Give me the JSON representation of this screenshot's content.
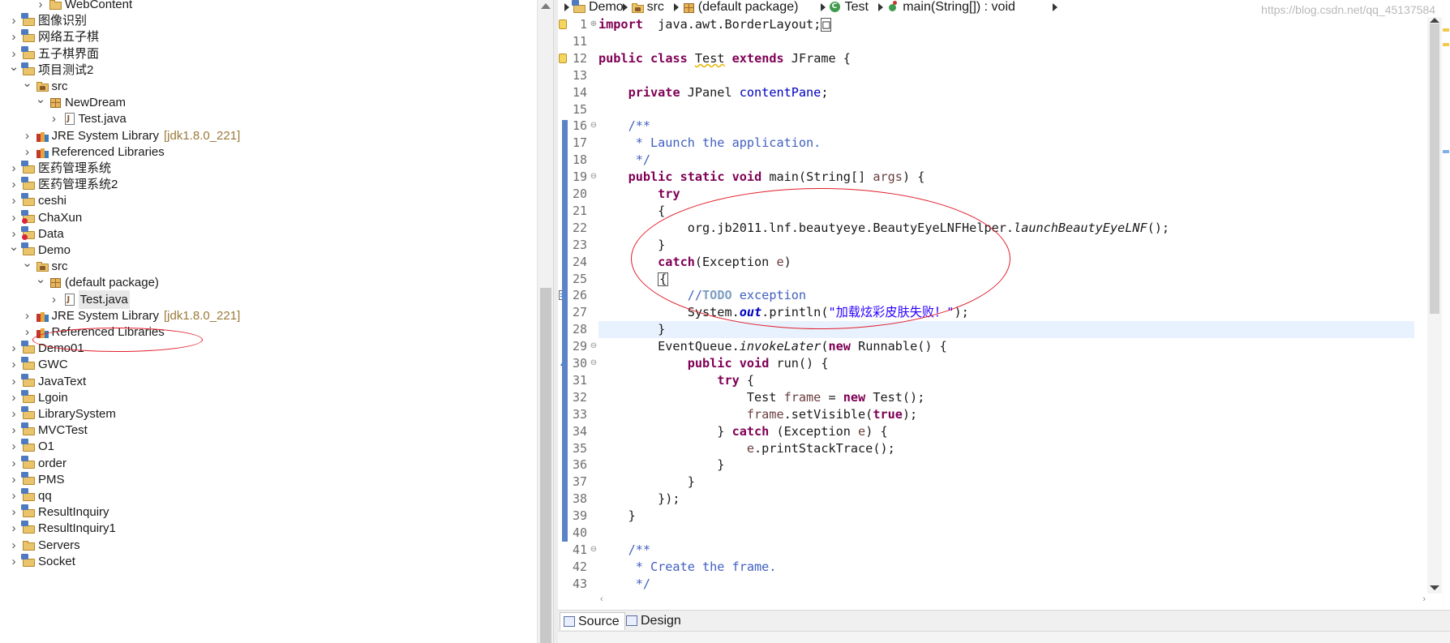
{
  "explorer": {
    "items": [
      {
        "label": "WebContent",
        "decoration": "",
        "twisty": "collapsed",
        "icon": "folder-icon",
        "indent": 2,
        "selected": false
      },
      {
        "label": "图像识别",
        "decoration": "",
        "twisty": "collapsed",
        "icon": "java-project-icon",
        "indent": 0,
        "selected": false
      },
      {
        "label": "网络五子棋",
        "decoration": "",
        "twisty": "collapsed",
        "icon": "java-project-icon",
        "indent": 0,
        "selected": false
      },
      {
        "label": "五子棋界面",
        "decoration": "",
        "twisty": "collapsed",
        "icon": "java-project-icon",
        "indent": 0,
        "selected": false
      },
      {
        "label": "项目测试2",
        "decoration": "",
        "twisty": "expanded",
        "icon": "java-project-icon",
        "indent": 0,
        "selected": false
      },
      {
        "label": "src",
        "decoration": "",
        "twisty": "expanded",
        "icon": "source-folder-icon",
        "indent": 1,
        "selected": false
      },
      {
        "label": "NewDream",
        "decoration": "",
        "twisty": "expanded",
        "icon": "package-icon",
        "indent": 2,
        "selected": false
      },
      {
        "label": "Test.java",
        "decoration": "",
        "twisty": "collapsed",
        "icon": "java-file-icon",
        "indent": 3,
        "selected": false
      },
      {
        "label": "JRE System Library",
        "decoration": "[jdk1.8.0_221]",
        "twisty": "collapsed",
        "icon": "library-icon",
        "indent": 1,
        "selected": false
      },
      {
        "label": "Referenced Libraries",
        "decoration": "",
        "twisty": "collapsed",
        "icon": "library-icon",
        "indent": 1,
        "selected": false
      },
      {
        "label": "医药管理系统",
        "decoration": "",
        "twisty": "collapsed",
        "icon": "java-project-icon",
        "indent": 0,
        "selected": false
      },
      {
        "label": "医药管理系统2",
        "decoration": "",
        "twisty": "collapsed",
        "icon": "java-project-icon",
        "indent": 0,
        "selected": false
      },
      {
        "label": "ceshi",
        "decoration": "",
        "twisty": "collapsed",
        "icon": "java-project-icon",
        "indent": 0,
        "selected": false
      },
      {
        "label": "ChaXun",
        "decoration": "",
        "twisty": "collapsed",
        "icon": "java-project-error-icon",
        "indent": 0,
        "selected": false
      },
      {
        "label": "Data",
        "decoration": "",
        "twisty": "collapsed",
        "icon": "java-project-error-icon",
        "indent": 0,
        "selected": false
      },
      {
        "label": "Demo",
        "decoration": "",
        "twisty": "expanded",
        "icon": "java-project-icon",
        "indent": 0,
        "selected": false
      },
      {
        "label": "src",
        "decoration": "",
        "twisty": "expanded",
        "icon": "source-folder-icon",
        "indent": 1,
        "selected": false
      },
      {
        "label": "(default package)",
        "decoration": "",
        "twisty": "expanded",
        "icon": "package-icon",
        "indent": 2,
        "selected": false
      },
      {
        "label": "Test.java",
        "decoration": "",
        "twisty": "collapsed",
        "icon": "java-file-icon",
        "indent": 3,
        "selected": true
      },
      {
        "label": "JRE System Library",
        "decoration": "[jdk1.8.0_221]",
        "twisty": "collapsed",
        "icon": "library-icon",
        "indent": 1,
        "selected": false
      },
      {
        "label": "Referenced Libraries",
        "decoration": "",
        "twisty": "collapsed",
        "icon": "library-icon",
        "indent": 1,
        "selected": false
      },
      {
        "label": "Demo01",
        "decoration": "",
        "twisty": "collapsed",
        "icon": "java-project-icon",
        "indent": 0,
        "selected": false
      },
      {
        "label": "GWC",
        "decoration": "",
        "twisty": "collapsed",
        "icon": "java-project-icon",
        "indent": 0,
        "selected": false
      },
      {
        "label": "JavaText",
        "decoration": "",
        "twisty": "collapsed",
        "icon": "java-project-icon",
        "indent": 0,
        "selected": false
      },
      {
        "label": "Lgoin",
        "decoration": "",
        "twisty": "collapsed",
        "icon": "java-project-icon",
        "indent": 0,
        "selected": false
      },
      {
        "label": "LibrarySystem",
        "decoration": "",
        "twisty": "collapsed",
        "icon": "java-project-icon",
        "indent": 0,
        "selected": false
      },
      {
        "label": "MVCTest",
        "decoration": "",
        "twisty": "collapsed",
        "icon": "java-project-icon",
        "indent": 0,
        "selected": false
      },
      {
        "label": "O1",
        "decoration": "",
        "twisty": "collapsed",
        "icon": "java-project-icon",
        "indent": 0,
        "selected": false
      },
      {
        "label": "order",
        "decoration": "",
        "twisty": "collapsed",
        "icon": "java-project-icon",
        "indent": 0,
        "selected": false
      },
      {
        "label": "PMS",
        "decoration": "",
        "twisty": "collapsed",
        "icon": "java-project-icon",
        "indent": 0,
        "selected": false
      },
      {
        "label": "qq",
        "decoration": "",
        "twisty": "collapsed",
        "icon": "java-project-icon",
        "indent": 0,
        "selected": false
      },
      {
        "label": "ResultInquiry",
        "decoration": "",
        "twisty": "collapsed",
        "icon": "java-project-icon",
        "indent": 0,
        "selected": false
      },
      {
        "label": "ResultInquiry1",
        "decoration": "",
        "twisty": "collapsed",
        "icon": "java-project-icon",
        "indent": 0,
        "selected": false
      },
      {
        "label": "Servers",
        "decoration": "",
        "twisty": "collapsed",
        "icon": "folder-icon",
        "indent": 0,
        "selected": false
      },
      {
        "label": "Socket",
        "decoration": "",
        "twisty": "collapsed",
        "icon": "java-project-icon",
        "indent": 0,
        "selected": false
      }
    ]
  },
  "breadcrumb": [
    {
      "label": "Demo",
      "icon": "java-project-icon"
    },
    {
      "label": "src",
      "icon": "source-folder-icon"
    },
    {
      "label": "(default package)",
      "icon": "package-icon"
    },
    {
      "label": "Test",
      "icon": "class-icon"
    },
    {
      "label": "main(String[]) : void",
      "icon": "method-icon"
    }
  ],
  "editor": {
    "current_line": 28,
    "lines": [
      {
        "num": "1",
        "fold": "⊕",
        "marker": "warning",
        "segments": [
          [
            "kw",
            "import"
          ],
          [
            "",
            "  java.awt.BorderLayout;"
          ],
          [
            "box",
            "□"
          ]
        ]
      },
      {
        "num": "11",
        "fold": "",
        "marker": "",
        "segments": []
      },
      {
        "num": "12",
        "fold": "",
        "marker": "warning",
        "segments": [
          [
            "kw",
            "public"
          ],
          [
            "",
            " "
          ],
          [
            "kw",
            "class"
          ],
          [
            "",
            " "
          ],
          [
            "warn",
            "Test"
          ],
          [
            "",
            " "
          ],
          [
            "kw",
            "extends"
          ],
          [
            "",
            " JFrame {"
          ]
        ]
      },
      {
        "num": "13",
        "fold": "",
        "marker": "",
        "segments": []
      },
      {
        "num": "14",
        "fold": "",
        "marker": "",
        "segments": [
          [
            "",
            "    "
          ],
          [
            "kw",
            "private"
          ],
          [
            "",
            " JPanel "
          ],
          [
            "fld",
            "contentPane"
          ],
          [
            "",
            ";"
          ]
        ]
      },
      {
        "num": "15",
        "fold": "",
        "marker": "",
        "segments": []
      },
      {
        "num": "16",
        "fold": "⊖",
        "marker": "",
        "segments": [
          [
            "",
            "    "
          ],
          [
            "cm",
            "/**"
          ]
        ]
      },
      {
        "num": "17",
        "fold": "",
        "marker": "",
        "segments": [
          [
            "",
            "     "
          ],
          [
            "cm",
            "* Launch the application."
          ]
        ]
      },
      {
        "num": "18",
        "fold": "",
        "marker": "",
        "segments": [
          [
            "",
            "     "
          ],
          [
            "cm",
            "*/"
          ]
        ]
      },
      {
        "num": "19",
        "fold": "⊖",
        "marker": "",
        "segments": [
          [
            "",
            "    "
          ],
          [
            "kw",
            "public"
          ],
          [
            "",
            " "
          ],
          [
            "kw",
            "static"
          ],
          [
            "",
            " "
          ],
          [
            "kw",
            "void"
          ],
          [
            "",
            " main(String[] "
          ],
          [
            "loc",
            "args"
          ],
          [
            "",
            ") {"
          ]
        ]
      },
      {
        "num": "20",
        "fold": "",
        "marker": "",
        "segments": [
          [
            "",
            "        "
          ],
          [
            "kw",
            "try"
          ]
        ]
      },
      {
        "num": "21",
        "fold": "",
        "marker": "",
        "segments": [
          [
            "",
            "        {"
          ]
        ]
      },
      {
        "num": "22",
        "fold": "",
        "marker": "",
        "segments": [
          [
            "",
            "            org.jb2011.lnf.beautyeye.BeautyEyeLNFHelper."
          ],
          [
            "ital",
            "launchBeautyEyeLNF"
          ],
          [
            "",
            "();"
          ]
        ]
      },
      {
        "num": "23",
        "fold": "",
        "marker": "",
        "segments": [
          [
            "",
            "        }"
          ]
        ]
      },
      {
        "num": "24",
        "fold": "",
        "marker": "",
        "segments": [
          [
            "",
            "        "
          ],
          [
            "kw",
            "catch"
          ],
          [
            "",
            "(Exception "
          ],
          [
            "loc",
            "e"
          ],
          [
            "",
            ")"
          ]
        ]
      },
      {
        "num": "25",
        "fold": "",
        "marker": "",
        "segments": [
          [
            "",
            "        "
          ],
          [
            "box",
            "{"
          ]
        ]
      },
      {
        "num": "26",
        "fold": "",
        "marker": "task",
        "segments": [
          [
            "",
            "            "
          ],
          [
            "cm",
            "//"
          ],
          [
            "tk",
            "TODO"
          ],
          [
            "cm",
            " exception"
          ]
        ]
      },
      {
        "num": "27",
        "fold": "",
        "marker": "",
        "segments": [
          [
            "",
            "            System."
          ],
          [
            "sfld",
            "out"
          ],
          [
            "",
            ".println("
          ],
          [
            "str",
            "\"加载炫彩皮肤失败！\""
          ],
          [
            "",
            ");"
          ]
        ]
      },
      {
        "num": "28",
        "fold": "",
        "marker": "",
        "segments": [
          [
            "",
            "        }"
          ]
        ]
      },
      {
        "num": "29",
        "fold": "⊖",
        "marker": "",
        "segments": [
          [
            "",
            "        EventQueue."
          ],
          [
            "ital",
            "invokeLater"
          ],
          [
            "",
            "("
          ],
          [
            "kw",
            "new"
          ],
          [
            "",
            " Runnable() {"
          ]
        ]
      },
      {
        "num": "30",
        "fold": "⊖",
        "marker": "override",
        "segments": [
          [
            "",
            "            "
          ],
          [
            "kw",
            "public"
          ],
          [
            "",
            " "
          ],
          [
            "kw",
            "void"
          ],
          [
            "",
            " run() {"
          ]
        ]
      },
      {
        "num": "31",
        "fold": "",
        "marker": "",
        "segments": [
          [
            "",
            "                "
          ],
          [
            "kw",
            "try"
          ],
          [
            "",
            " {"
          ]
        ]
      },
      {
        "num": "32",
        "fold": "",
        "marker": "",
        "segments": [
          [
            "",
            "                    Test "
          ],
          [
            "loc",
            "frame"
          ],
          [
            "",
            " = "
          ],
          [
            "kw",
            "new"
          ],
          [
            "",
            " Test();"
          ]
        ]
      },
      {
        "num": "33",
        "fold": "",
        "marker": "",
        "segments": [
          [
            "",
            "                    "
          ],
          [
            "loc",
            "frame"
          ],
          [
            "",
            ".setVisible("
          ],
          [
            "kw",
            "true"
          ],
          [
            "",
            ");"
          ]
        ]
      },
      {
        "num": "34",
        "fold": "",
        "marker": "",
        "segments": [
          [
            "",
            "                } "
          ],
          [
            "kw",
            "catch"
          ],
          [
            "",
            " (Exception "
          ],
          [
            "loc",
            "e"
          ],
          [
            "",
            ") {"
          ]
        ]
      },
      {
        "num": "35",
        "fold": "",
        "marker": "",
        "segments": [
          [
            "",
            "                    "
          ],
          [
            "loc",
            "e"
          ],
          [
            "",
            ".printStackTrace();"
          ]
        ]
      },
      {
        "num": "36",
        "fold": "",
        "marker": "",
        "segments": [
          [
            "",
            "                }"
          ]
        ]
      },
      {
        "num": "37",
        "fold": "",
        "marker": "",
        "segments": [
          [
            "",
            "            }"
          ]
        ]
      },
      {
        "num": "38",
        "fold": "",
        "marker": "",
        "segments": [
          [
            "",
            "        });"
          ]
        ]
      },
      {
        "num": "39",
        "fold": "",
        "marker": "",
        "segments": [
          [
            "",
            "    }"
          ]
        ]
      },
      {
        "num": "40",
        "fold": "",
        "marker": "",
        "segments": []
      },
      {
        "num": "41",
        "fold": "⊖",
        "marker": "",
        "segments": [
          [
            "",
            "    "
          ],
          [
            "cm",
            "/**"
          ]
        ]
      },
      {
        "num": "42",
        "fold": "",
        "marker": "",
        "segments": [
          [
            "",
            "     "
          ],
          [
            "cm",
            "* Create the frame."
          ]
        ]
      },
      {
        "num": "43",
        "fold": "",
        "marker": "",
        "segments": [
          [
            "",
            "     "
          ],
          [
            "cm",
            "*/"
          ]
        ]
      }
    ]
  },
  "bottom_tabs": {
    "source_label": "Source",
    "design_label": "Design",
    "active": "Source"
  },
  "watermark": "https://blog.csdn.net/qq_45137584",
  "colors": {
    "keyword": "#7f0055",
    "comment": "#3f5fbf",
    "string": "#2a00ff",
    "field": "#0000c0",
    "current_line": "#e8f2fe",
    "annotation_red": "#e11d2a",
    "change_band": "#5b84c7"
  }
}
